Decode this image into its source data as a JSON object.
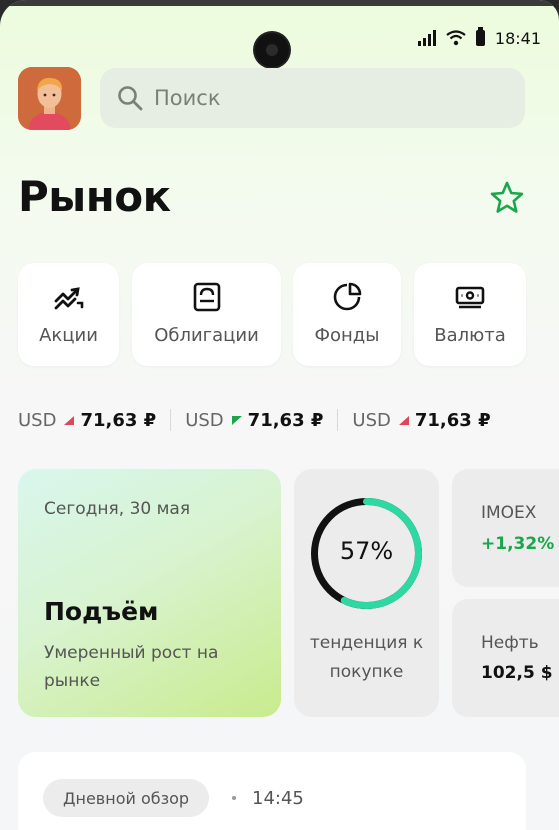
{
  "status": {
    "time": "18:41"
  },
  "header": {
    "search_placeholder": "Поиск",
    "title": "Рынок"
  },
  "categories": [
    {
      "label": "Акции",
      "icon": "stocks-icon"
    },
    {
      "label": "Облигации",
      "icon": "bonds-icon"
    },
    {
      "label": "Фонды",
      "icon": "funds-icon"
    },
    {
      "label": "Валюта",
      "icon": "currency-icon"
    }
  ],
  "ticker": [
    {
      "currency": "USD",
      "value": "71,63 ₽",
      "direction": "down"
    },
    {
      "currency": "USD",
      "value": "71,63 ₽",
      "direction": "up"
    },
    {
      "currency": "USD",
      "value": "71,63 ₽",
      "direction": "down"
    }
  ],
  "market_mood": {
    "date": "Сегодня, 30 мая",
    "headline": "Подъём",
    "description": "Умеренный рост на рынке"
  },
  "trend": {
    "percent": "57%",
    "fraction": 0.57,
    "caption": "тенденция к покупке"
  },
  "indices": [
    {
      "name": "IMOEX",
      "value": "+1,32%"
    },
    {
      "name": "Нефть",
      "value": "102,5 $"
    }
  ],
  "review": {
    "tag": "Дневной обзор",
    "time": "14:45"
  },
  "colors": {
    "accent_green": "#1aa64a",
    "down_red": "#e0465a",
    "gauge_teal": "#2ed8a3",
    "gauge_track": "#111111"
  }
}
